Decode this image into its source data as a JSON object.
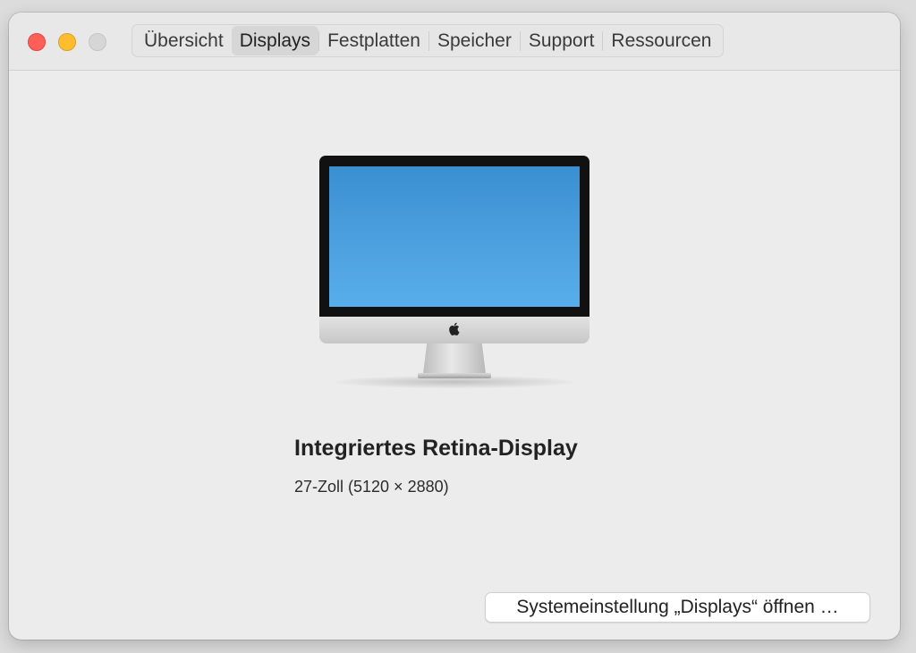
{
  "tabs": [
    {
      "label": "Übersicht"
    },
    {
      "label": "Displays"
    },
    {
      "label": "Festplatten"
    },
    {
      "label": "Speicher"
    },
    {
      "label": "Support"
    },
    {
      "label": "Ressourcen"
    }
  ],
  "active_tab": "Displays",
  "display": {
    "name": "Integriertes Retina-Display",
    "size": "27-Zoll (5120 × 2880)",
    "icon": "imac-icon"
  },
  "actions": {
    "open_settings_label": "Systemeinstellung „Displays“ öffnen …"
  },
  "colors": {
    "close": "#fe5f57",
    "minimize": "#febc2e",
    "zoom": "#d6d6d6",
    "screen": "#4ea2e0"
  }
}
